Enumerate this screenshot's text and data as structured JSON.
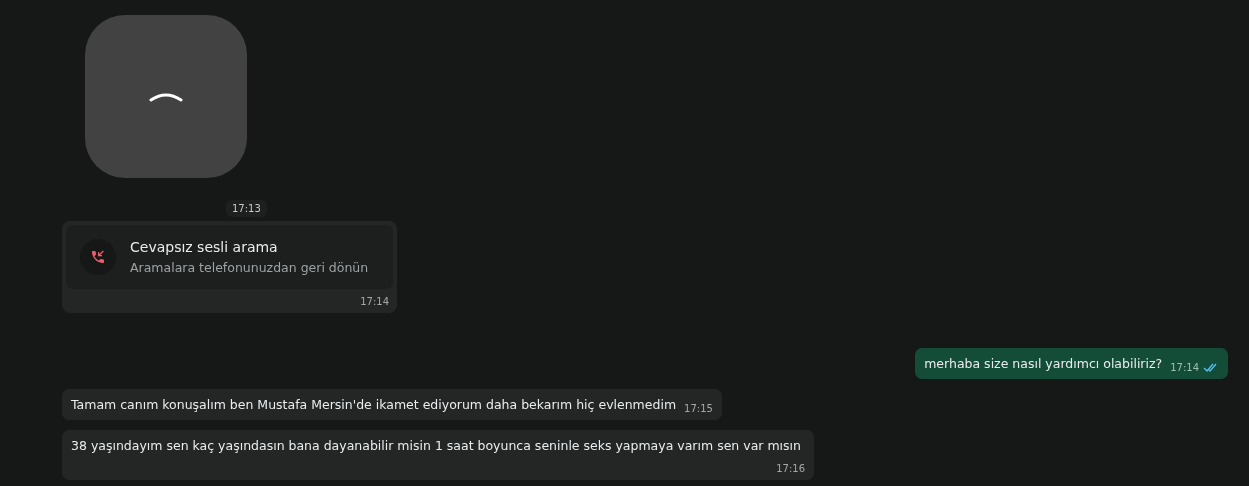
{
  "sticker": {
    "kind": "loading",
    "time": "17:13"
  },
  "call": {
    "title": "Cevapsız sesli arama",
    "subtitle": "Aramalara telefonunuzdan geri dönün",
    "time": "17:14"
  },
  "messages": [
    {
      "kind": "outgoing",
      "text": "merhaba size nasıl yardımcı olabiliriz?",
      "time": "17:14",
      "read": true
    },
    {
      "kind": "incoming",
      "text": "Tamam canım konuşalım ben Mustafa Mersin'de ikamet ediyorum daha bekarım hiç evlenmedim",
      "time": "17:15"
    },
    {
      "kind": "incoming",
      "text": "38 yaşındayım sen kaç yaşındasın bana dayanabilir misin 1 saat boyunca seninle seks yapmaya varım sen var mısın",
      "time": "17:16"
    }
  ]
}
